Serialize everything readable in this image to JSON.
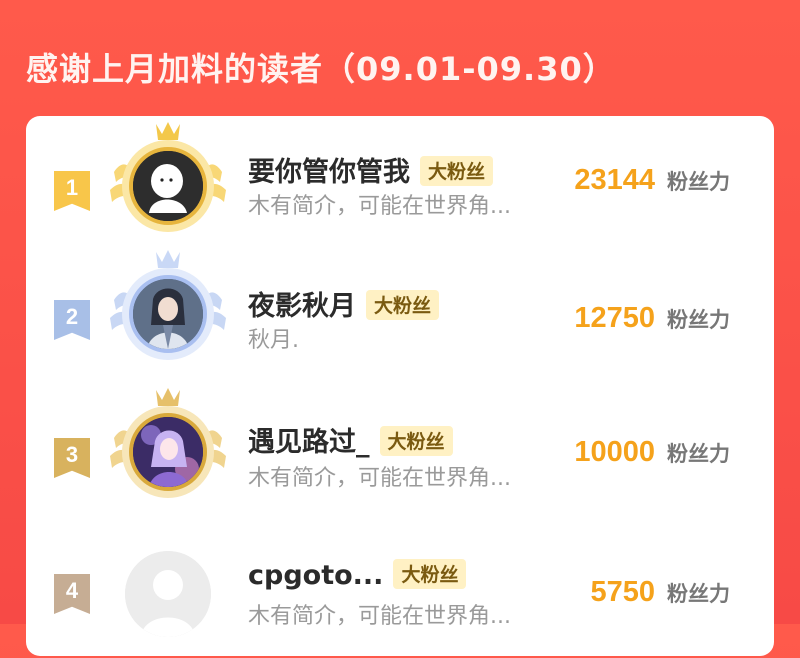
{
  "header": {
    "title": "感谢上月加料的读者（09.01-09.30）"
  },
  "colors": {
    "background": "#f74a46",
    "accent_number": "#f5a21b",
    "badge_bg": "#fff1c4"
  },
  "leaderboard": [
    {
      "rank": "1",
      "name": "要你管你管我",
      "badge": "大粉丝",
      "intro": "木有简介，可能在世界角...",
      "score": "23144",
      "unit": "粉丝力",
      "frame": "gold-crown-wings"
    },
    {
      "rank": "2",
      "name": "夜影秋月",
      "badge": "大粉丝",
      "intro": "秋月.",
      "score": "12750",
      "unit": "粉丝力",
      "frame": "silver-crown-wings"
    },
    {
      "rank": "3",
      "name": "遇见路过_",
      "badge": "大粉丝",
      "intro": "木有简介，可能在世界角...",
      "score": "10000",
      "unit": "粉丝力",
      "frame": "bronze-crown-wings"
    },
    {
      "rank": "4",
      "name": "cpgoto...",
      "badge": "大粉丝",
      "intro": "木有简介，可能在世界角...",
      "score": "5750",
      "unit": "粉丝力",
      "frame": "none"
    }
  ]
}
